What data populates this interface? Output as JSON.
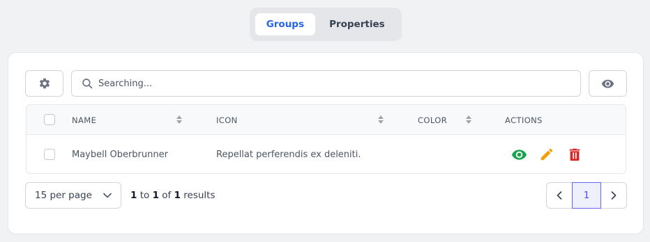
{
  "tabs": [
    {
      "label": "Groups",
      "active": true
    },
    {
      "label": "Properties",
      "active": false
    }
  ],
  "toolbar": {
    "settings_icon": "gear-icon",
    "search_placeholder": "Searching...",
    "search_value": "",
    "visibility_icon": "eye-icon"
  },
  "table": {
    "columns": [
      "NAME",
      "ICON",
      "COLOR",
      "ACTIONS"
    ],
    "rows": [
      {
        "name": "Maybell Oberbrunner",
        "icon": "Repellat perferendis ex deleniti.",
        "color": ""
      }
    ],
    "row_actions": [
      "view-icon",
      "edit-icon",
      "delete-icon"
    ]
  },
  "pagination": {
    "per_page_label": "15 per page",
    "results_from": "1",
    "results_to_word": "to",
    "results_to": "1",
    "results_of_word": "of",
    "results_total": "1",
    "results_word": "results",
    "current_page": "1"
  },
  "colors": {
    "accent": "#2563eb",
    "view": "#16a34a",
    "edit": "#f59e0b",
    "delete": "#dc2626",
    "current_page": "#6366f1"
  }
}
